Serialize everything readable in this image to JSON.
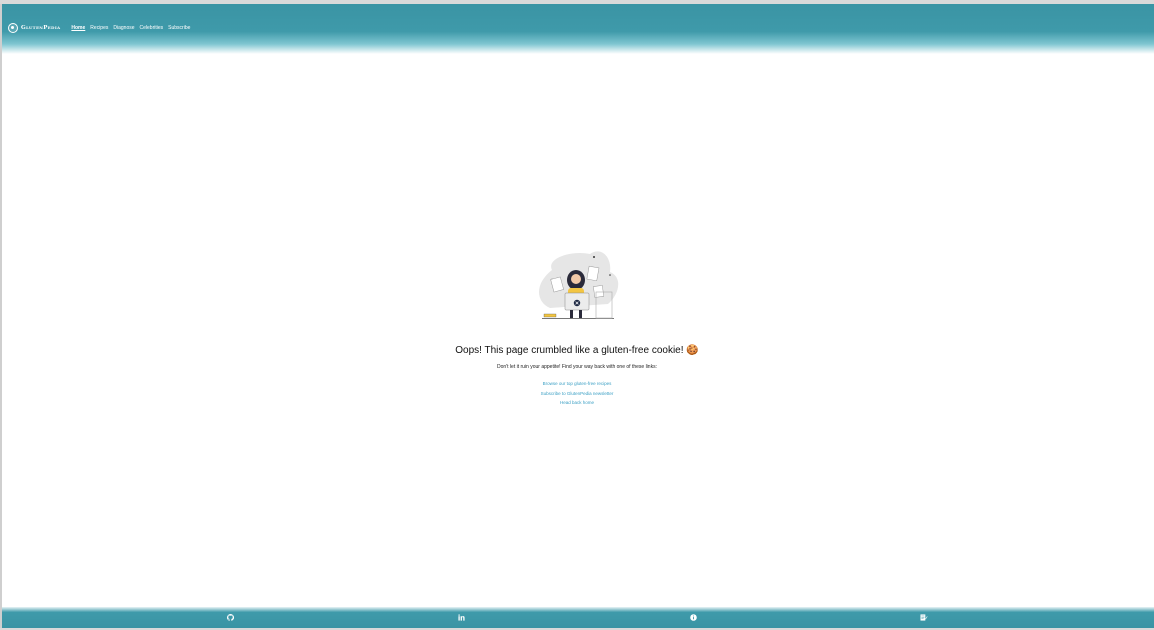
{
  "header": {
    "logo_text": "GlutenPedia",
    "nav": [
      {
        "label": "Home",
        "active": true
      },
      {
        "label": "Recipes",
        "active": false
      },
      {
        "label": "Diagnose",
        "active": false
      },
      {
        "label": "Celebrities",
        "active": false
      },
      {
        "label": "Subscribe",
        "active": false
      }
    ]
  },
  "main": {
    "title": "Oops! This page crumbled like a gluten-free cookie! 🍪",
    "subtitle": "Don't let it ruin your appetite! Find your way back with one of these links:",
    "links": [
      "Browse our top gluten-free recipes",
      "Subscribe to GlutenPedia newsletter",
      "Head back home"
    ]
  },
  "footer": {
    "icons": [
      "github-icon",
      "linkedin-icon",
      "info-icon",
      "blog-icon"
    ]
  },
  "colors": {
    "header": "#3a94a4",
    "link": "#3a9fc4"
  }
}
